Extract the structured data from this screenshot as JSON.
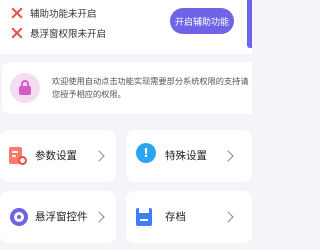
{
  "status": {
    "accessibility_off": "辅助功能未开启",
    "overlay_permission_off": "悬浮窗权限未开启",
    "enable_button": "开启辅助功能"
  },
  "info": {
    "text": "欢迎使用自动点击功能实现需要部分系统权限的支持请您授予相应的权限。"
  },
  "tiles": {
    "params": "参数设置",
    "special": "特殊设置",
    "floating_widget": "悬浮窗控件",
    "archive": "存档"
  },
  "icons": {
    "status_icon": "close-x-icon",
    "lock": "lock-icon",
    "params": "document-gear-icon",
    "special": "exclamation-circle-icon",
    "floating_widget": "ring-icon",
    "archive": "save-icon",
    "chevron": "chevron-right-icon"
  },
  "colors": {
    "accent": "#6f63e8",
    "error": "#e65050",
    "lock": "#d65bc9",
    "params": "#ff7a6e",
    "special": "#2aa6f0",
    "archive": "#3d7df5",
    "background": "#f4f4f9"
  }
}
